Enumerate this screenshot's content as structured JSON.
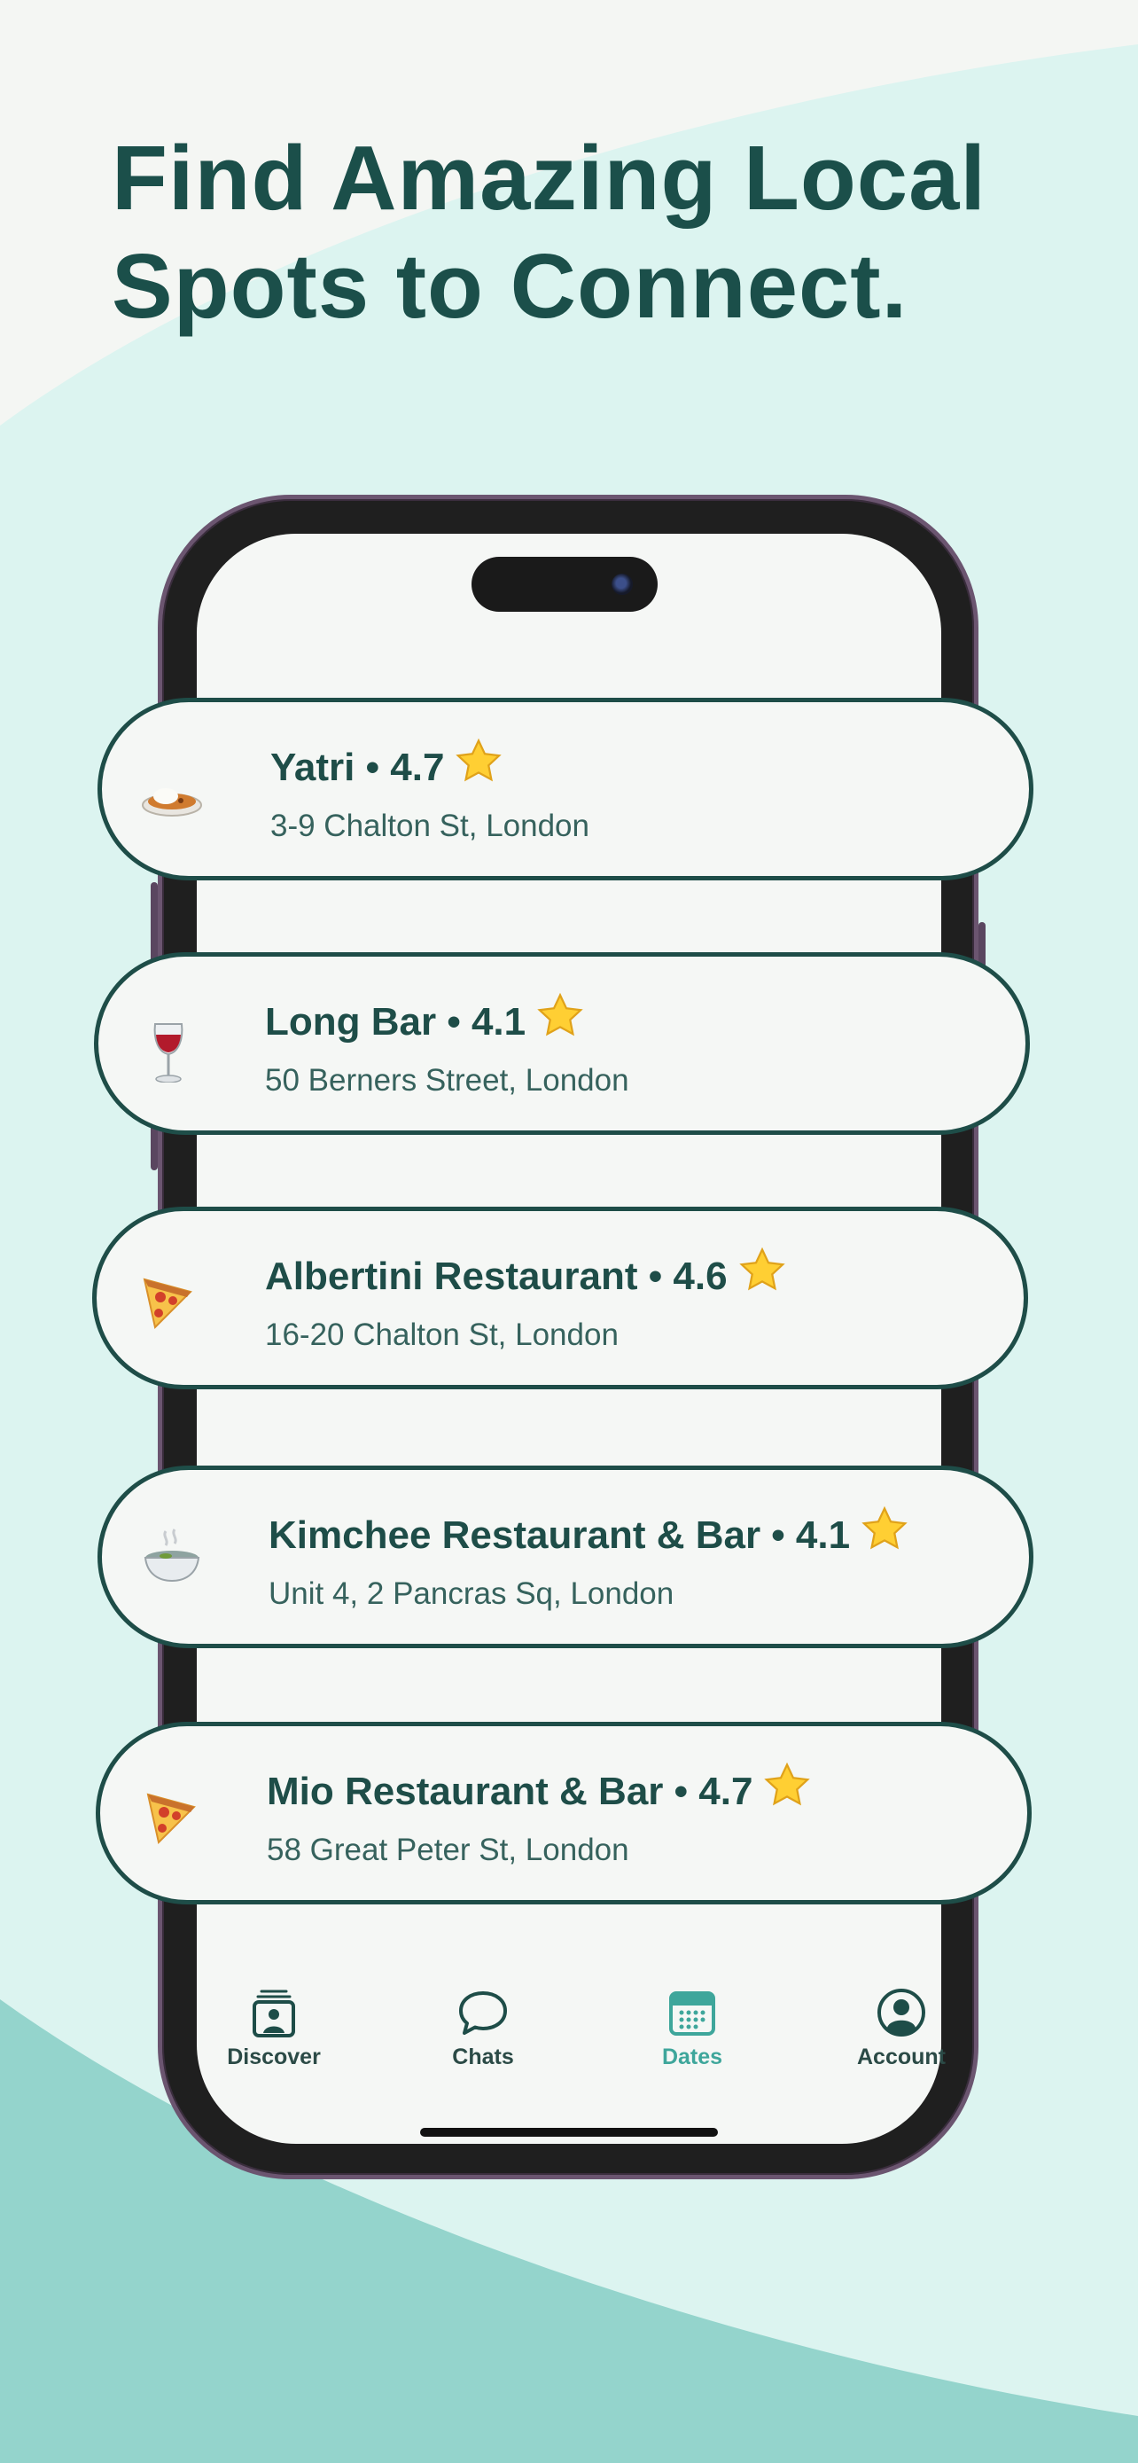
{
  "headline": {
    "line1": "Find Amazing Local",
    "line2": "Spots to Connect."
  },
  "colors": {
    "accent_dark": "#1e4d48",
    "accent_teal": "#3ea69b",
    "background_light": "#dcf4f0",
    "background_teal": "#94d4cc"
  },
  "places": [
    {
      "name": "Yatri",
      "rating": "4.7",
      "title": "Yatri • 4.7",
      "address": "3-9 Chalton St, London",
      "icon": "curry-rice-icon"
    },
    {
      "name": "Long Bar",
      "rating": "4.1",
      "title": "Long Bar • 4.1",
      "address": "50 Berners Street, London",
      "icon": "wine-glass-icon"
    },
    {
      "name": "Albertini Restaurant",
      "rating": "4.6",
      "title": "Albertini Restaurant • 4.6",
      "address": "16-20 Chalton St, London",
      "icon": "pizza-icon"
    },
    {
      "name": "Kimchee Restaurant & Bar",
      "rating": "4.1",
      "title": "Kimchee Restaurant & Bar • 4.1",
      "address": "Unit 4, 2 Pancras Sq, London",
      "icon": "steaming-bowl-icon"
    },
    {
      "name": "Mio Restaurant & Bar",
      "rating": "4.7",
      "title": "Mio Restaurant & Bar • 4.7",
      "address": "58 Great Peter St, London",
      "icon": "pizza-icon"
    }
  ],
  "tabbar": {
    "active": "Dates",
    "tabs": [
      {
        "label": "Discover",
        "icon": "discover-icon"
      },
      {
        "label": "Chats",
        "icon": "chat-bubble-icon"
      },
      {
        "label": "Dates",
        "icon": "calendar-icon"
      },
      {
        "label": "Account",
        "icon": "account-icon"
      }
    ]
  }
}
